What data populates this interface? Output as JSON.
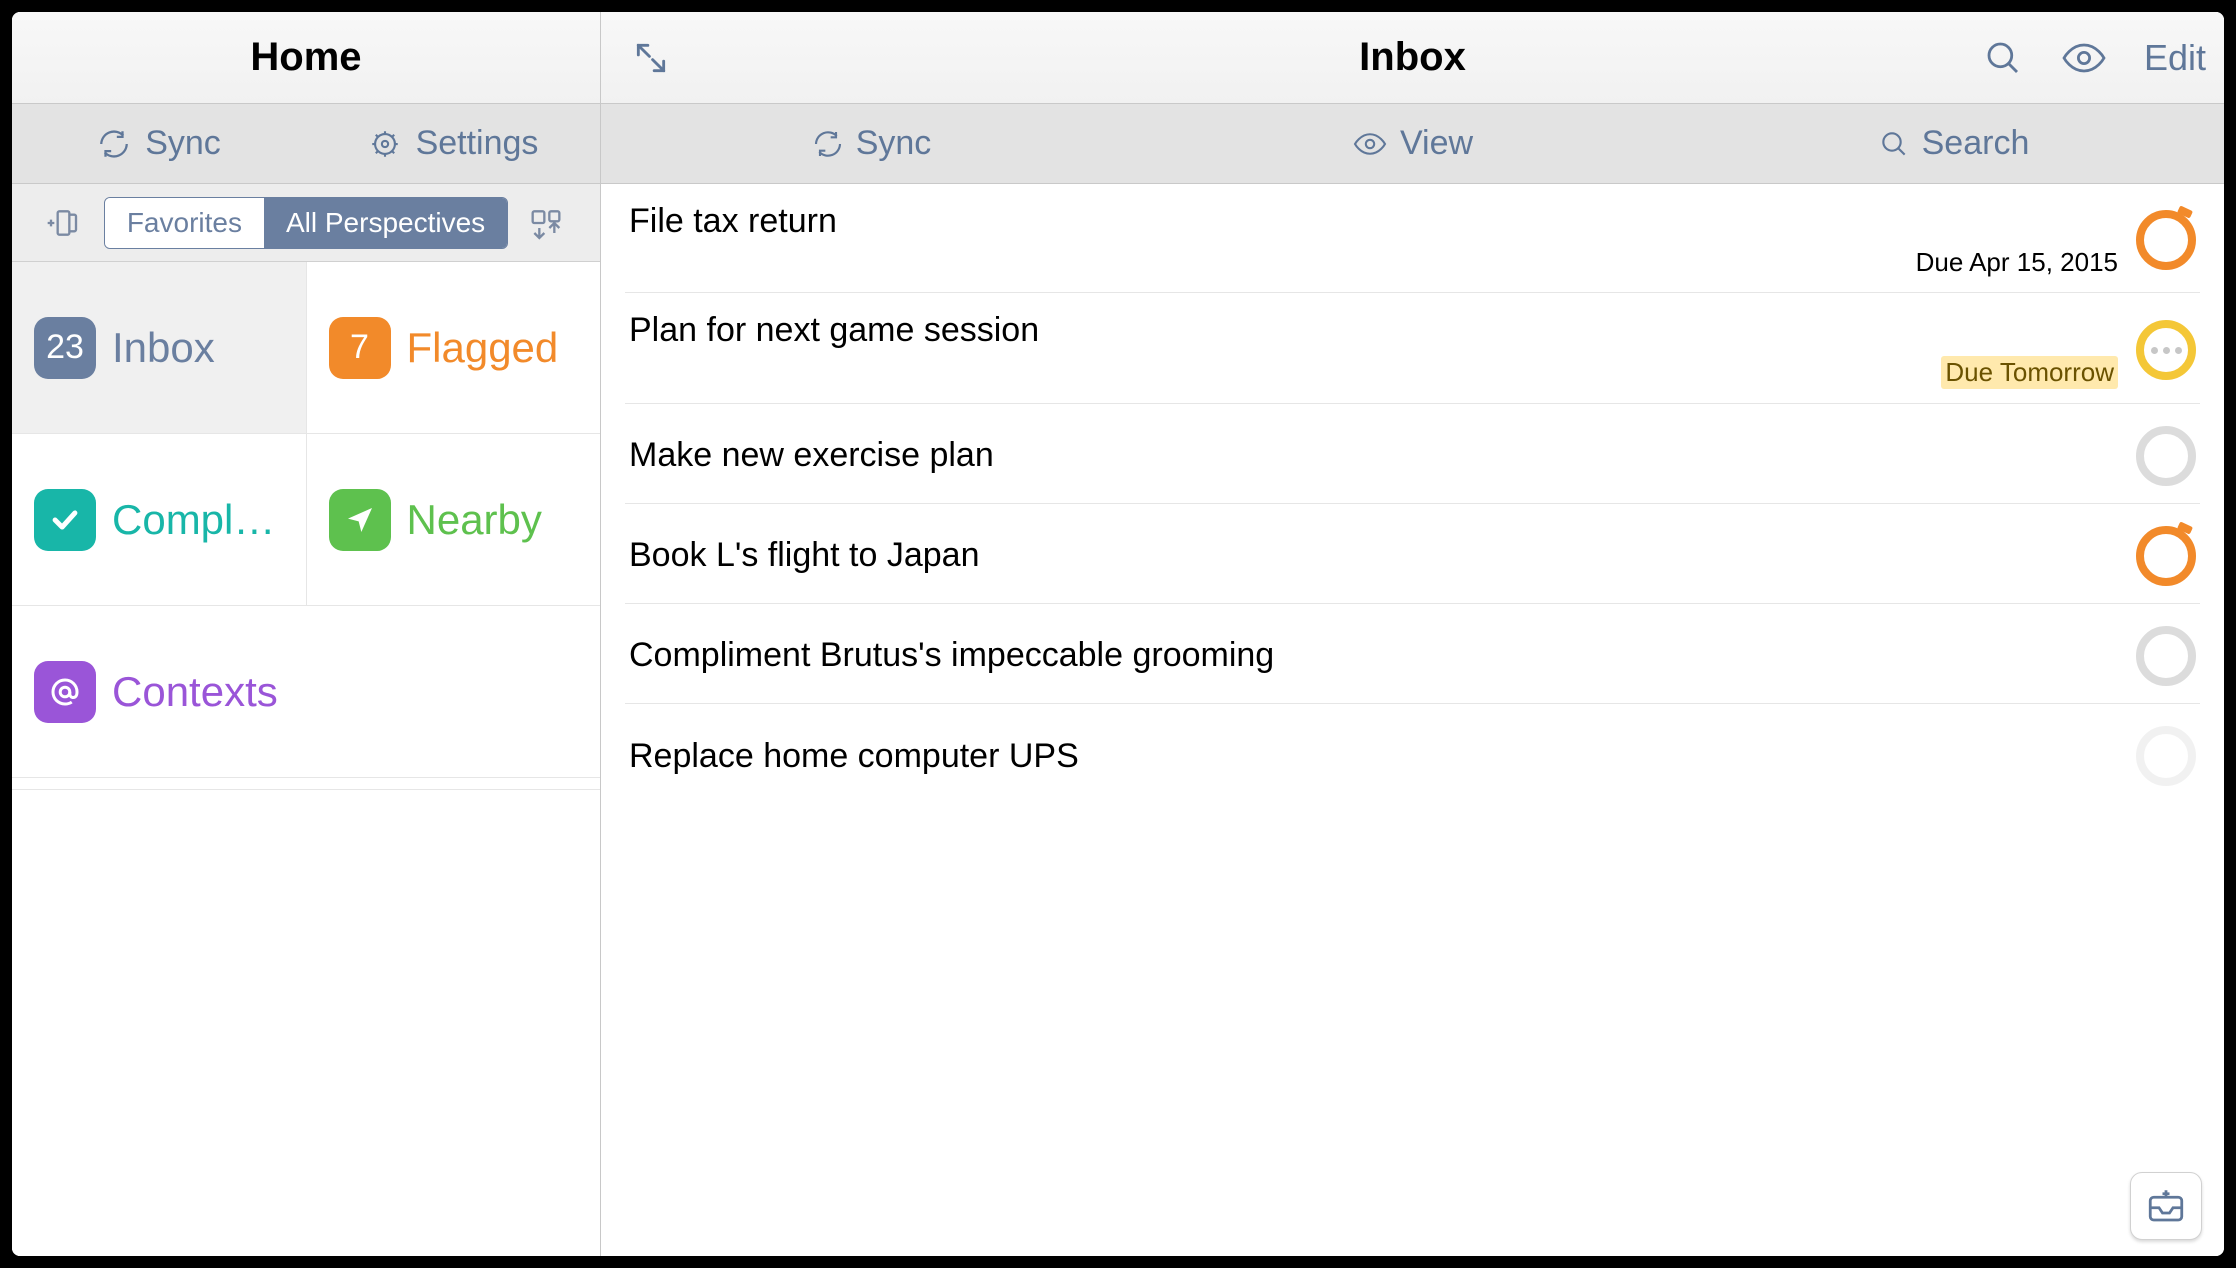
{
  "left": {
    "title": "Home",
    "toolbar": {
      "sync": "Sync",
      "settings": "Settings"
    },
    "segmented": {
      "favorites": "Favorites",
      "all": "All Perspectives"
    },
    "tiles": {
      "inbox": {
        "count": "23",
        "label": "Inbox"
      },
      "flagged": {
        "count": "7",
        "label": "Flagged"
      },
      "completed": {
        "label": "Compl…"
      },
      "nearby": {
        "label": "Nearby"
      },
      "contexts": {
        "label": "Contexts"
      }
    }
  },
  "right": {
    "title": "Inbox",
    "edit": "Edit",
    "toolbar": {
      "sync": "Sync",
      "view": "View",
      "search": "Search"
    },
    "tasks": [
      {
        "title": "File tax return",
        "due": "Due Apr 15, 2015",
        "status": "overdue"
      },
      {
        "title": "Plan for next game session",
        "due": "Due Tomorrow",
        "status": "due-soon"
      },
      {
        "title": "Make new exercise plan",
        "due": "",
        "status": "none"
      },
      {
        "title": "Book L's flight to Japan",
        "due": "",
        "status": "overdue"
      },
      {
        "title": "Compliment Brutus's impeccable grooming",
        "due": "",
        "status": "none"
      },
      {
        "title": "Replace home computer UPS",
        "due": "",
        "status": "none"
      }
    ]
  }
}
